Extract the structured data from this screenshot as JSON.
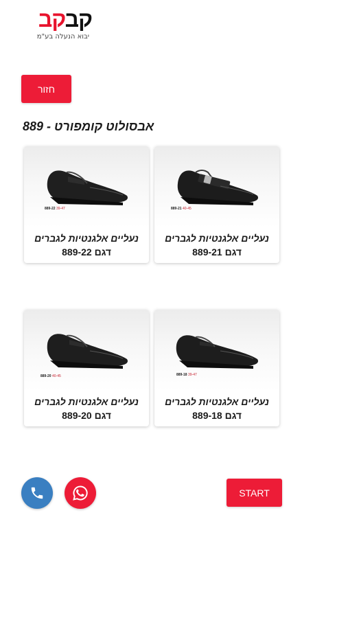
{
  "logo": {
    "text_part1": "קב",
    "text_part2": "קב",
    "subtitle": "יבוא הנעלה בע\"מ"
  },
  "header": {
    "back_label": "חזור",
    "title": "אבסולוט קומפורט - 889"
  },
  "products": [
    {
      "name": "נעליים אלגנטיות לגברים",
      "model": "דגם 889-21",
      "code": "889-21",
      "sizes": "40-45"
    },
    {
      "name": "נעליים אלגנטיות לגברים",
      "model": "דגם 889-22",
      "code": "889-22",
      "sizes": "39-47"
    },
    {
      "name": "נעליים אלגנטיות לגברים",
      "model": "דגם 889-18",
      "code": "889-18",
      "sizes": "39-47"
    },
    {
      "name": "נעליים אלגנטיות לגברים",
      "model": "דגם 889-20",
      "code": "889-20",
      "sizes": "40-45"
    }
  ],
  "footer": {
    "start_label": "START",
    "phone_icon": "phone-icon",
    "whatsapp_icon": "whatsapp-icon"
  },
  "colors": {
    "accent": "#ed1c37",
    "phone": "#3a7fc1"
  }
}
